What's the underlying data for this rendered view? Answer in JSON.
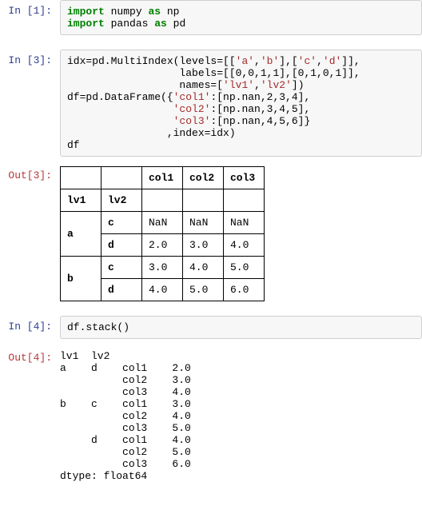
{
  "cells": {
    "c1": {
      "prompt": "In  [1]:",
      "imp": "import",
      "numpy": "numpy",
      "as1": "as",
      "np": "np",
      "pandas": "pandas",
      "as2": "as",
      "pd": "pd"
    },
    "c3": {
      "prompt": "In  [3]:",
      "l1a": "idx=pd.MultiIndex(levels=[[",
      "s1": "'a'",
      "c1": ",",
      "s2": "'b'",
      "l1b": "],[",
      "s3": "'c'",
      "c2": ",",
      "s4": "'d'",
      "l1c": "]],",
      "l2a": "                  labels=[[0,0,1,1],[0,1,0,1]],",
      "l3a": "                  names=[",
      "s5": "'lv1'",
      "c3": ",",
      "s6": "'lv2'",
      "l3b": "])",
      "l4a": "df=pd.DataFrame({",
      "s7": "'col1'",
      "l4b": ":[np.nan,2,3,4],",
      "l5a": "                 ",
      "s8": "'col2'",
      "l5b": ":[np.nan,3,4,5],",
      "l6a": "                 ",
      "s9": "'col3'",
      "l6b": ":[np.nan,4,5,6]}",
      "l7": "                ,index=idx)",
      "l8": "df"
    },
    "out3": {
      "prompt": "Out[3]:",
      "cols": [
        "col1",
        "col2",
        "col3"
      ],
      "idx_names": [
        "lv1",
        "lv2"
      ],
      "rows": [
        {
          "lv1": "a",
          "lv2": "c",
          "vals": [
            "NaN",
            "NaN",
            "NaN"
          ]
        },
        {
          "lv1": "",
          "lv2": "d",
          "vals": [
            "2.0",
            "3.0",
            "4.0"
          ]
        },
        {
          "lv1": "b",
          "lv2": "c",
          "vals": [
            "3.0",
            "4.0",
            "5.0"
          ]
        },
        {
          "lv1": "",
          "lv2": "d",
          "vals": [
            "4.0",
            "5.0",
            "6.0"
          ]
        }
      ]
    },
    "c4": {
      "prompt": "In  [4]:",
      "code": "df.stack()"
    },
    "out4": {
      "prompt": "Out[4]:",
      "text": "lv1  lv2      \na    d    col1    2.0\n          col2    3.0\n          col3    4.0\nb    c    col1    3.0\n          col2    4.0\n          col3    5.0\n     d    col1    4.0\n          col2    5.0\n          col3    6.0\ndtype: float64"
    }
  }
}
